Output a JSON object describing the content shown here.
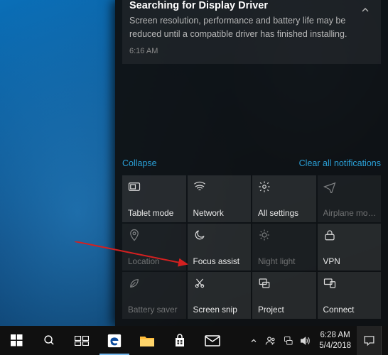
{
  "notification": {
    "title": "Searching for Display Driver",
    "body": "Screen resolution, performance and battery life may be reduced until a compatible driver has finished installing.",
    "time": "6:16 AM"
  },
  "links": {
    "collapse": "Collapse",
    "clear": "Clear all notifications"
  },
  "tiles": [
    {
      "label": "Tablet mode",
      "icon": "tablet",
      "dim": false
    },
    {
      "label": "Network",
      "icon": "network",
      "dim": false
    },
    {
      "label": "All settings",
      "icon": "gear",
      "dim": false
    },
    {
      "label": "Airplane mode",
      "icon": "airplane",
      "dim": true
    },
    {
      "label": "Location",
      "icon": "location",
      "dim": true
    },
    {
      "label": "Focus assist",
      "icon": "moon",
      "dim": false
    },
    {
      "label": "Night light",
      "icon": "sun",
      "dim": true
    },
    {
      "label": "VPN",
      "icon": "vpn",
      "dim": false
    },
    {
      "label": "Battery saver",
      "icon": "leaf",
      "dim": true
    },
    {
      "label": "Screen snip",
      "icon": "snip",
      "dim": false
    },
    {
      "label": "Project",
      "icon": "project",
      "dim": false
    },
    {
      "label": "Connect",
      "icon": "connect",
      "dim": false
    }
  ],
  "taskbar": {
    "apps": [
      "start",
      "search",
      "task-view",
      "edge",
      "explorer",
      "store",
      "mail"
    ],
    "tray": [
      "chevron-up",
      "people",
      "network",
      "volume"
    ],
    "clock": {
      "time": "6:28 AM",
      "date": "5/4/2018"
    }
  }
}
